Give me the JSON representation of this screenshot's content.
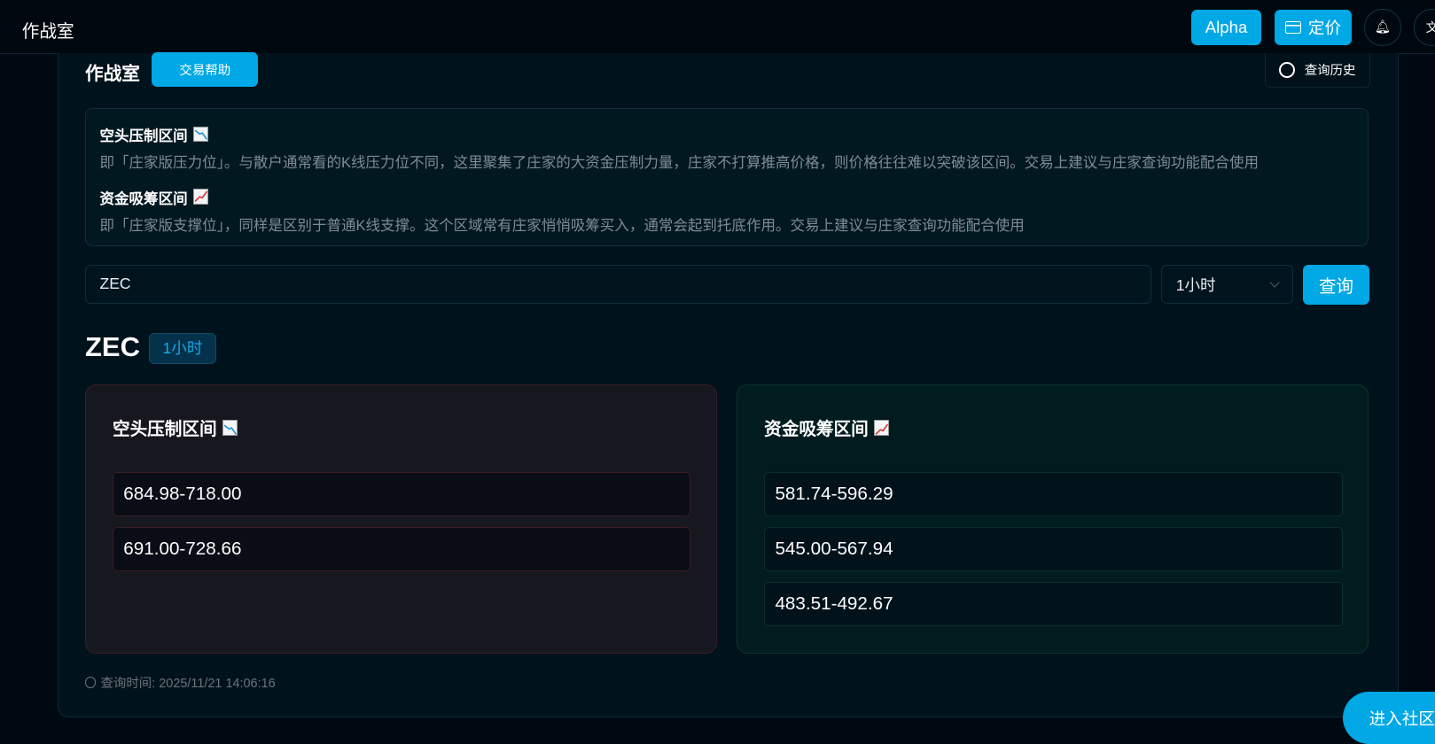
{
  "header": {
    "title": "作战室",
    "alpha_label": "Alpha",
    "pricing_label": "定价"
  },
  "page": {
    "title": "作战室",
    "help_label": "交易帮助",
    "history_label": "查询历史"
  },
  "info": {
    "short_title": "空头压制区间",
    "short_desc": "即「庄家版压力位」。与散户通常看的K线压力位不同，这里聚集了庄家的大资金压制力量，庄家不打算推高价格，则价格往往难以突破该区间。交易上建议与庄家查询功能配合使用",
    "long_title": "资金吸筹区间",
    "long_desc": "即「庄家版支撑位」，同样是区别于普通K线支撑。这个区域常有庄家悄悄吸筹买入，通常会起到托底作用。交易上建议与庄家查询功能配合使用"
  },
  "search": {
    "value": "ZEC",
    "interval": "1小时",
    "query_label": "查询"
  },
  "result": {
    "symbol": "ZEC",
    "interval_badge": "1小时"
  },
  "short_card": {
    "title": "空头压制区间",
    "ranges": [
      "684.98-718.00",
      "691.00-728.66"
    ]
  },
  "long_card": {
    "title": "资金吸筹区间",
    "ranges": [
      "581.74-596.29",
      "545.00-567.94",
      "483.51-492.67"
    ]
  },
  "footer": {
    "query_time": "查询时间: 2025/11/21 14:06:16"
  },
  "community_label": "进入社区",
  "colors": {
    "accent": "#00a8e6",
    "short_border": "#3a1e24",
    "long_border": "#0c3328"
  }
}
